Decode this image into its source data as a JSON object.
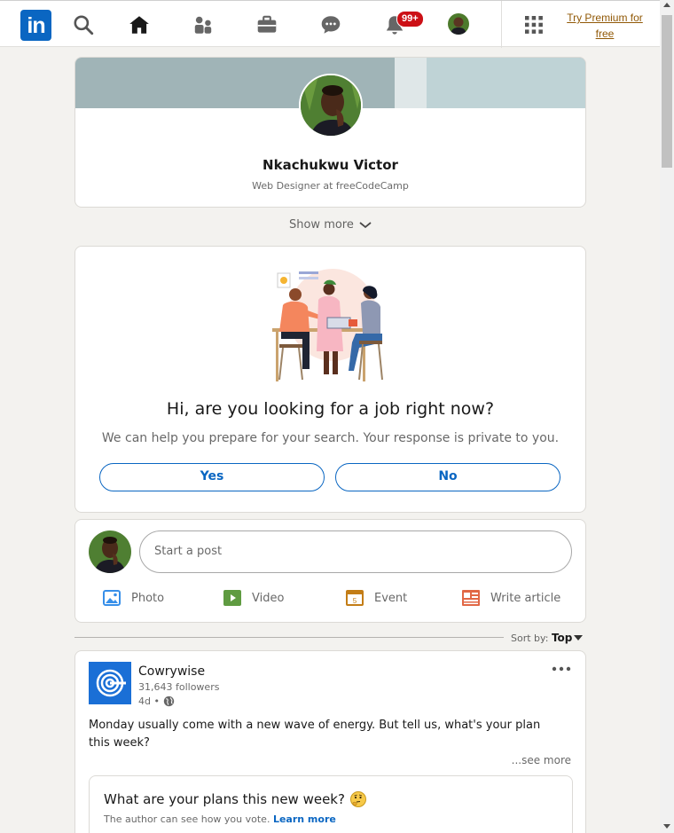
{
  "nav": {
    "logo_text": "in",
    "notification_count": "99+",
    "premium_label": "Try Premium for free"
  },
  "profile": {
    "name": "Nkachukwu Victor",
    "headline": "Web Designer at freeCodeCamp"
  },
  "show_more_label": "Show more",
  "job_prompt": {
    "title": "Hi, are you looking for a job right now?",
    "subtitle": "We can help you prepare for your search. Your response is private to you.",
    "yes_label": "Yes",
    "no_label": "No"
  },
  "share_box": {
    "placeholder": "Start a post",
    "actions": [
      {
        "label": "Photo",
        "icon": "photo-icon",
        "color": "#378fe9"
      },
      {
        "label": "Video",
        "icon": "video-icon",
        "color": "#5f9b41"
      },
      {
        "label": "Event",
        "icon": "event-icon",
        "color": "#c37d16"
      },
      {
        "label": "Write article",
        "icon": "article-icon",
        "color": "#e16745"
      }
    ]
  },
  "sort": {
    "label": "Sort by:",
    "value": "Top"
  },
  "post": {
    "company": "Cowrywise",
    "followers": "31,643 followers",
    "time": "4d •",
    "text": "Monday usually come with a new wave of energy. But tell us, what's your plan this week?",
    "see_more": "...see more",
    "poll_question": "What are your plans this new week?",
    "poll_note": "The author can see how you vote.",
    "poll_link": "Learn more"
  },
  "colors": {
    "brand": "#0a66c2",
    "badge": "#cc1016",
    "premium": "#915907"
  }
}
